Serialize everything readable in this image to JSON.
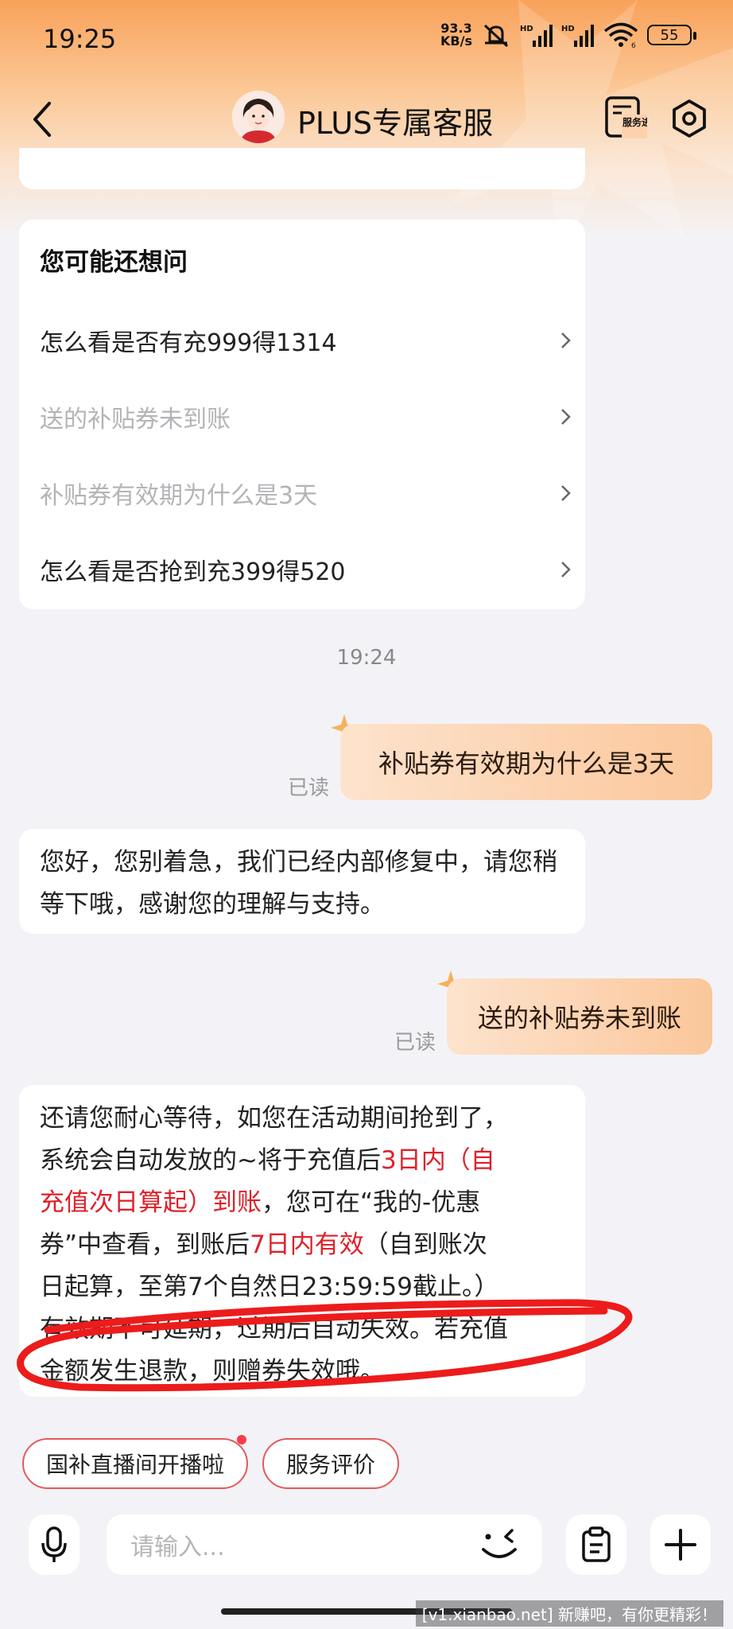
{
  "status": {
    "time": "19:25",
    "net_speed": "93.3",
    "net_unit": "KB/s",
    "hd1": "HD",
    "hd2": "HD",
    "wifi_label": "6",
    "battery": "55"
  },
  "header": {
    "title": "PLUS专属客服",
    "service_progress": "服务进度"
  },
  "suggest": {
    "heading": "您可能还想问",
    "items": [
      {
        "label": "怎么看是否有充999得1314",
        "state": "normal"
      },
      {
        "label": "送的补贴券未到账",
        "state": "disabled"
      },
      {
        "label": "补贴券有效期为什么是3天",
        "state": "disabled"
      },
      {
        "label": "怎么看是否抢到充399得520",
        "state": "normal"
      }
    ]
  },
  "chat": {
    "timestamp": "19:24",
    "messages": [
      {
        "from": "me",
        "text": "补贴券有效期为什么是3天",
        "read": "已读"
      },
      {
        "from": "bot",
        "text": "您好，您别着急，我们已经内部修复中，请您稍等下哦，感谢您的理解与支持。"
      },
      {
        "from": "me",
        "text": "送的补贴券未到账",
        "read": "已读"
      },
      {
        "from": "bot",
        "line1": "还请您耐心等待，如您在活动期间抢到了，",
        "line2a": "系统会自动发放的~将于充值后",
        "line2b": "3日内（自",
        "line3a": "充值次日算起）到账",
        "line3b": "，您可在“我的-优惠",
        "line4a": "券”中查看，到账后",
        "line4b": "7日内有效",
        "line4c": "（自到账次",
        "line5": "日起算，至第7个自然日23:59:59截止。）",
        "line6": "有效期不可延期，过期后自动失效。若充值",
        "line7": "金额发生退款，则赠券失效哦。"
      }
    ]
  },
  "quick_chips": [
    {
      "label": "国补直播间开播啦",
      "has_dot": true
    },
    {
      "label": "服务评价",
      "has_dot": false
    }
  ],
  "input": {
    "placeholder": "请输入..."
  },
  "watermark": "[v1.xianbao.net] 新赚吧，有你更精彩！",
  "colors": {
    "accent_red": "#e0202a",
    "header_orange": "#f9a25a",
    "my_bubble": "#fbc79b"
  }
}
